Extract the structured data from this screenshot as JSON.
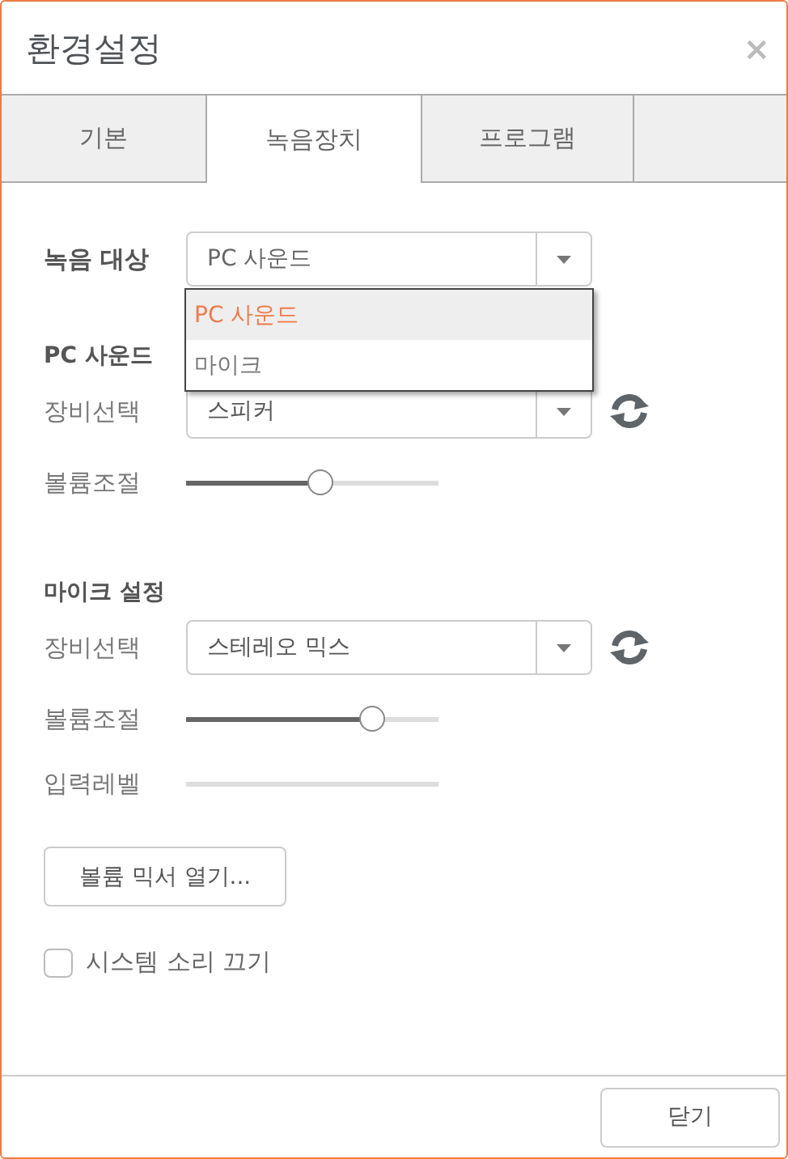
{
  "window": {
    "title": "환경설정",
    "close": "×"
  },
  "tabs": [
    {
      "label": "기본",
      "selected": false
    },
    {
      "label": "녹음장치",
      "selected": true
    },
    {
      "label": "프로그램",
      "selected": false
    },
    {
      "selected": false
    }
  ],
  "target": {
    "label": "녹음 대상",
    "value": "PC 사운드",
    "open": true,
    "options": [
      {
        "label": "PC 사운드",
        "selected": true
      },
      {
        "label": "마이크",
        "selected": false
      }
    ]
  },
  "sections": [
    {
      "heading": "PC 사운드",
      "rows": [
        {
          "kind": "select",
          "label": "장비선택",
          "value": "스피커"
        },
        {
          "kind": "slider",
          "label": "볼륨조절",
          "level": 0.53
        }
      ]
    },
    {
      "heading": "마이크 설정",
      "rows": [
        {
          "kind": "select",
          "label": "장비선택",
          "value": "스테레오 믹스"
        },
        {
          "kind": "slider",
          "label": "볼륨조절",
          "level": 0.74
        },
        {
          "kind": "meter",
          "label": "입력레벨",
          "level": 0
        }
      ]
    }
  ],
  "mixer_button": "볼륨 믹서 열기...",
  "mute_system": {
    "label": "시스템 소리 끄기",
    "checked": false
  },
  "footer_button": "닫기"
}
